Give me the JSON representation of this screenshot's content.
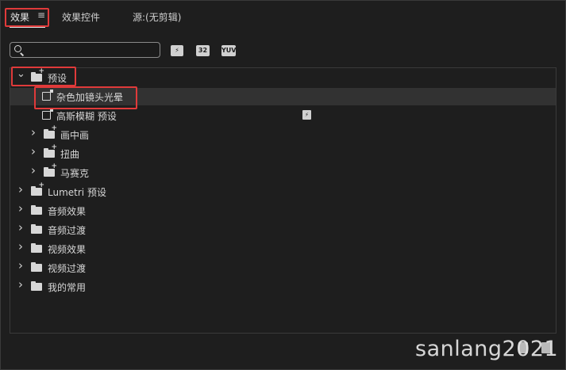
{
  "tabs": {
    "effects": "效果",
    "menu_glyph": "≡",
    "effect_controls": "效果控件",
    "source": "源:(无剪辑)"
  },
  "search": {
    "value": "",
    "placeholder": ""
  },
  "toolbar": {
    "accelerated_badge": "⚡",
    "bit32_badge": "32",
    "yuv_badge": "YUV"
  },
  "tree": [
    {
      "label": "预设",
      "depth": 0,
      "expanded": true,
      "kind": "bin"
    },
    {
      "label": "杂色加镜头光晕",
      "depth": 1,
      "kind": "preset",
      "selected": true
    },
    {
      "label": "高斯模糊 预设",
      "depth": 1,
      "kind": "preset",
      "badge": true
    },
    {
      "label": "画中画",
      "depth": 1,
      "expanded": false,
      "kind": "bin"
    },
    {
      "label": "扭曲",
      "depth": 1,
      "expanded": false,
      "kind": "bin"
    },
    {
      "label": "马赛克",
      "depth": 1,
      "expanded": false,
      "kind": "bin"
    },
    {
      "label": "Lumetri 预设",
      "depth": 0,
      "expanded": false,
      "kind": "bin"
    },
    {
      "label": "音频效果",
      "depth": 0,
      "expanded": false,
      "kind": "folder"
    },
    {
      "label": "音频过渡",
      "depth": 0,
      "expanded": false,
      "kind": "folder"
    },
    {
      "label": "视频效果",
      "depth": 0,
      "expanded": false,
      "kind": "folder"
    },
    {
      "label": "视频过渡",
      "depth": 0,
      "expanded": false,
      "kind": "folder"
    },
    {
      "label": "我的常用",
      "depth": 0,
      "expanded": false,
      "kind": "folder"
    }
  ],
  "watermark": "sanlang2021",
  "colors": {
    "highlight": "#e03a3a",
    "selected_row": "#323232",
    "background": "#1e1e1e"
  }
}
